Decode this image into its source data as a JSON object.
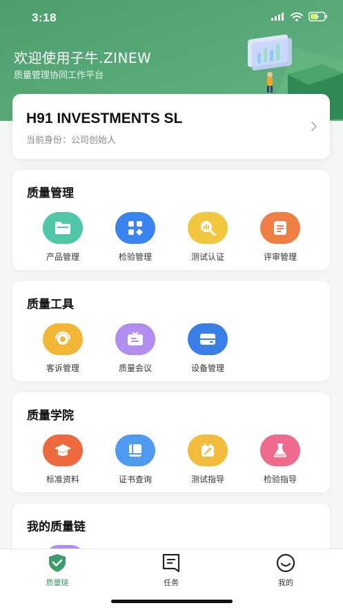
{
  "status_bar": {
    "time": "3:18",
    "icons": [
      "signal-icon",
      "wifi-icon",
      "battery-charging-icon"
    ]
  },
  "header": {
    "title": "欢迎使用子牛.ZINEW",
    "subtitle": "质量管理协同工作平台"
  },
  "company": {
    "name": "H91 INVESTMENTS SL",
    "role": "当前身份：公司创始人"
  },
  "sections": [
    {
      "title": "质量管理",
      "items": [
        {
          "label": "产品管理",
          "icon": "folder-icon",
          "color": "#4fc7a8"
        },
        {
          "label": "检验管理",
          "icon": "grid-icon",
          "color": "#3a84f0"
        },
        {
          "label": "测试认证",
          "icon": "chart-search-icon",
          "color": "#f3c640"
        },
        {
          "label": "评审管理",
          "icon": "document-icon",
          "color": "#ef7f45"
        }
      ]
    },
    {
      "title": "质量工具",
      "items": [
        {
          "label": "客诉管理",
          "icon": "headset-icon",
          "color": "#f2b636"
        },
        {
          "label": "质量会议",
          "icon": "meeting-screen-icon",
          "color": "#b18df0"
        },
        {
          "label": "设备管理",
          "icon": "device-icon",
          "color": "#3a7fe8"
        }
      ]
    },
    {
      "title": "质量学院",
      "items": [
        {
          "label": "标准资料",
          "icon": "graduation-cap-icon",
          "color": "#ee6a3e"
        },
        {
          "label": "证书查询",
          "icon": "book-icon",
          "color": "#4d9af0"
        },
        {
          "label": "测试指导",
          "icon": "tool-calendar-icon",
          "color": "#f2bd3a"
        },
        {
          "label": "检验指导",
          "icon": "flask-icon",
          "color": "#f06a8e"
        }
      ]
    },
    {
      "title": "我的质量链",
      "items": []
    }
  ],
  "tabbar": {
    "items": [
      {
        "label": "质量链",
        "icon": "shield-check-icon",
        "active": true
      },
      {
        "label": "任务",
        "icon": "task-icon",
        "active": false
      },
      {
        "label": "我的",
        "icon": "smile-icon",
        "active": false
      }
    ],
    "active_color": "#3d9b6a"
  }
}
